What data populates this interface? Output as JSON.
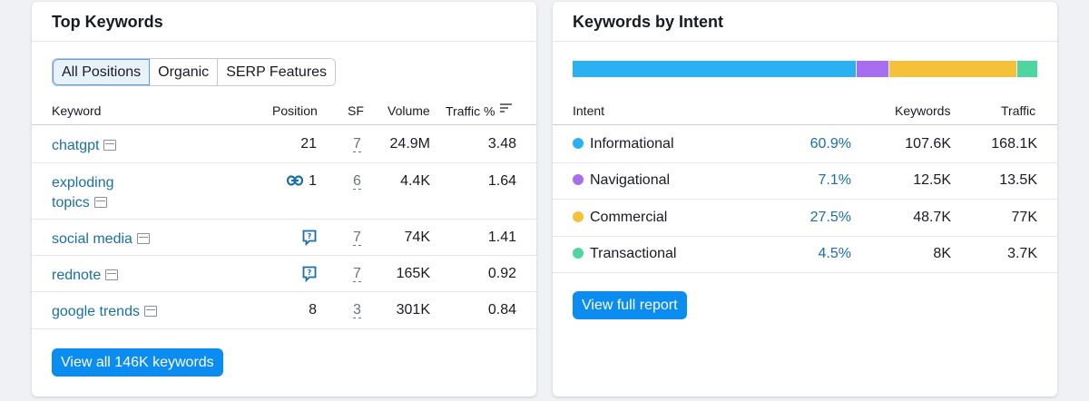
{
  "left": {
    "title": "Top Keywords",
    "tabs": [
      "All Positions",
      "Organic",
      "SERP Features"
    ],
    "active_tab": 0,
    "columns": {
      "keyword": "Keyword",
      "position": "Position",
      "sf": "SF",
      "volume": "Volume",
      "traffic": "Traffic %"
    },
    "rows": [
      {
        "keyword": "chatgpt",
        "keyword_line2": "",
        "position": "21",
        "position_icon": "",
        "sf": "7",
        "volume": "24.9M",
        "traffic": "3.48"
      },
      {
        "keyword": "exploding",
        "keyword_line2": "topics",
        "position": "1",
        "position_icon": "link-icon",
        "sf": "6",
        "volume": "4.4K",
        "traffic": "1.64"
      },
      {
        "keyword": "social media",
        "keyword_line2": "",
        "position": "",
        "position_icon": "question-bubble-icon",
        "sf": "7",
        "volume": "74K",
        "traffic": "1.41"
      },
      {
        "keyword": "rednote",
        "keyword_line2": "",
        "position": "",
        "position_icon": "question-bubble-icon",
        "sf": "7",
        "volume": "165K",
        "traffic": "0.92"
      },
      {
        "keyword": "google trends",
        "keyword_line2": "",
        "position": "8",
        "position_icon": "",
        "sf": "3",
        "volume": "301K",
        "traffic": "0.84"
      }
    ],
    "button_label": "View all 146K keywords"
  },
  "right": {
    "title": "Keywords by Intent",
    "columns": {
      "intent": "Intent",
      "keywords": "Keywords",
      "traffic": "Traffic"
    },
    "rows": [
      {
        "intent": "Informational",
        "pct": "60.9%",
        "keywords": "107.6K",
        "traffic": "168.1K",
        "color": "#2bb0f2",
        "share": 60.9
      },
      {
        "intent": "Navigational",
        "pct": "7.1%",
        "keywords": "12.5K",
        "traffic": "13.5K",
        "color": "#a86ef0",
        "share": 7.1
      },
      {
        "intent": "Commercial",
        "pct": "27.5%",
        "keywords": "48.7K",
        "traffic": "77K",
        "color": "#f5c13b",
        "share": 27.5
      },
      {
        "intent": "Transactional",
        "pct": "4.5%",
        "keywords": "8K",
        "traffic": "3.7K",
        "color": "#4fd6a0",
        "share": 4.5
      }
    ],
    "button_label": "View full report"
  }
}
